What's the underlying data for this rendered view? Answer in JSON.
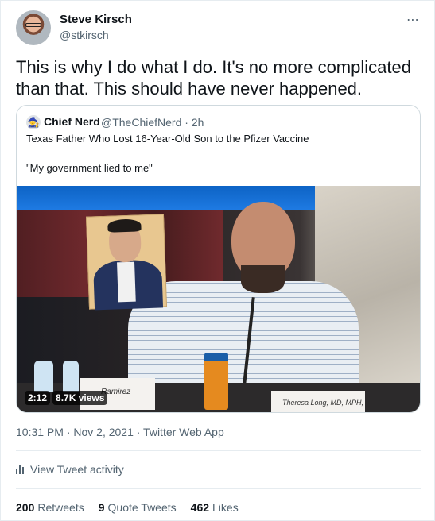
{
  "author": {
    "name": "Steve Kirsch",
    "handle": "@stkirsch"
  },
  "more_icon": "⋯",
  "tweet": {
    "text": "This is why I do what I do. It's no more complicated than that. This should have never happened."
  },
  "quote": {
    "avatar_glyph": "🧙",
    "name": "Chief Nerd",
    "handle_time": "@TheChiefNerd · 2h",
    "line1": "Texas Father Who Lost 16-Year-Old Son to the Pfizer Vaccine",
    "line2": "\"My government lied to me\"",
    "media": {
      "duration": "2:12",
      "views": "8.7K views",
      "nameplate1": "Ramirez",
      "nameplate2": "Theresa Long, MD, MPH, FS"
    }
  },
  "timestamp": "10:31 PM · Nov 2, 2021 · Twitter Web App",
  "activity_label": "View Tweet activity",
  "stats": [
    {
      "count": "200",
      "label": "Retweets"
    },
    {
      "count": "9",
      "label": "Quote Tweets"
    },
    {
      "count": "462",
      "label": "Likes"
    }
  ]
}
